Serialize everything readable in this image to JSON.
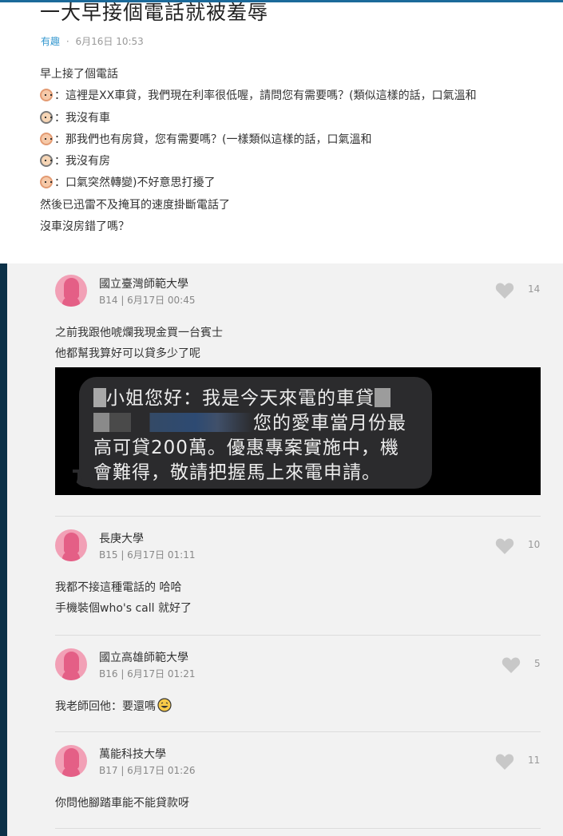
{
  "post": {
    "title": "一大早接個電話就被羞辱",
    "forum": "有趣",
    "separator": "·",
    "datetime": "6月16日 10:53",
    "lines": [
      "早上接了個電話",
      "：這裡是XX車貸，我們現在利率很低喔，請問您有需要嗎？(類似這樣的話，口氣溫和",
      "：我沒有車",
      "：那我們也有房貸，您有需要嗎？(一樣類似這樣的話，口氣溫和",
      "：我沒有房",
      "：口氣突然轉變)不好意思打擾了",
      "然後已迅雷不及掩耳的速度掛斷電話了",
      "沒車沒房錯了嗎？"
    ]
  },
  "comments": [
    {
      "school": "國立臺灣師範大學",
      "meta": "B14 | 6月17日 00:45",
      "likes": "14",
      "lines": [
        "之前我跟他唬爛我現金買一台賓士",
        "他都幫我算好可以貸多少了呢"
      ],
      "image": {
        "sms_lines": [
          "小姐您好：我是今天來電的車貸",
          "您的愛車當月份最",
          "高可貸200萬。優惠專案實施中，機",
          "會難得，敬請把握馬上來電申請。"
        ]
      }
    },
    {
      "school": "長庚大學",
      "meta": "B15 | 6月17日 01:11",
      "likes": "10",
      "lines": [
        "我都不接這種電話的 哈哈",
        "手機裝個who's call 就好了"
      ]
    },
    {
      "school": "國立高雄師範大學",
      "meta": "B16 | 6月17日 01:21",
      "likes": "5",
      "lines": [
        "我老師回他：要還嗎"
      ]
    },
    {
      "school": "萬能科技大學",
      "meta": "B17 | 6月17日 01:26",
      "likes": "11",
      "lines": [
        "你問他腳踏車能不能貸款呀"
      ]
    }
  ],
  "colors": {
    "accent": "#3397cf",
    "sidebar": "#0c3148",
    "avatar": "#f2a0b6",
    "heart": "#c8c8c8"
  }
}
